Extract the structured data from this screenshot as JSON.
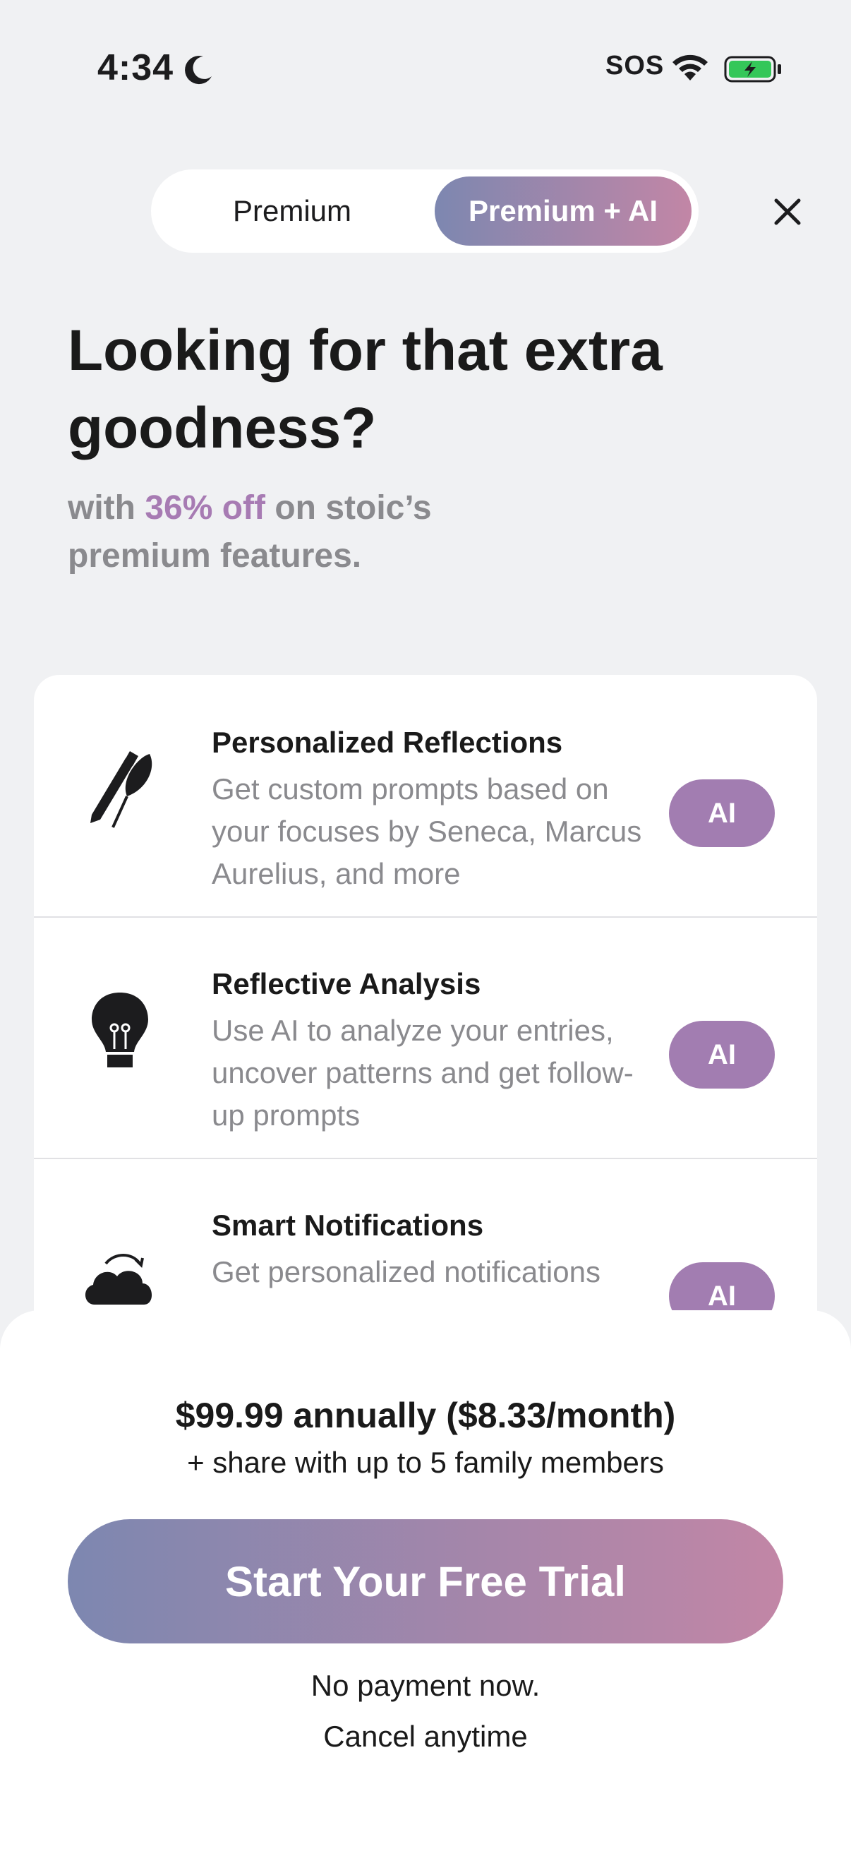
{
  "status_bar": {
    "time": "4:34",
    "moon_icon": "moon-icon",
    "carrier": "SOS",
    "wifi_icon": "wifi-icon",
    "battery_icon": "battery-charging-icon"
  },
  "plan_toggle": {
    "options": [
      "Premium",
      "Premium + AI"
    ],
    "selected": "Premium + AI"
  },
  "close_icon": "close-icon",
  "headline": "Looking for that extra goodness?",
  "subhead": {
    "prefix": "with ",
    "discount": "36% off",
    "suffix": " on stoic’s premium features."
  },
  "features": [
    {
      "icon": "pen-and-quill-icon",
      "title": "Personalized Reflections",
      "description": "Get custom prompts based on your focuses by Seneca, Marcus Aurelius, and more",
      "badge": "AI"
    },
    {
      "icon": "lightbulb-icon",
      "title": "Reflective Analysis",
      "description": "Use AI to analyze your entries, uncover patterns and get follow-up prompts",
      "badge": "AI"
    },
    {
      "icon": "cloud-sync-icon",
      "title": "Smart Notifications",
      "description": "Get personalized notifications",
      "badge": "AI"
    }
  ],
  "pricing": {
    "price_line": "$99.99 annually ($8.33/month)",
    "family_line": "+ share with up to 5 family members",
    "cta_label": "Start Your Free Trial",
    "note_1": "No payment now.",
    "note_2": "Cancel anytime"
  },
  "colors": {
    "gradient_start": "#7d87b0",
    "gradient_end": "#c286a6",
    "accent": "#a77bb3",
    "badge": "#a27db1",
    "background": "#f0f1f3"
  }
}
